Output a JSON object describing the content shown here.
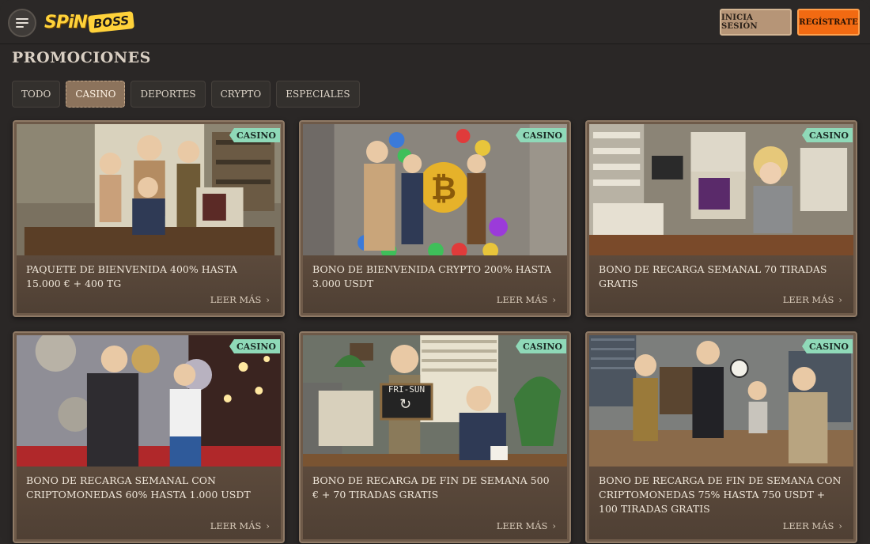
{
  "header": {
    "logo_main": "SPiN",
    "logo_sub": "BOSS",
    "login_label": "INICIA SESIÓN",
    "register_label": "REGÍSTRATE"
  },
  "page_title": "PROMOCIONES",
  "tabs": [
    {
      "label": "TODO",
      "active": false
    },
    {
      "label": "CASINO",
      "active": true
    },
    {
      "label": "DEPORTES",
      "active": false
    },
    {
      "label": "CRYPTO",
      "active": false
    },
    {
      "label": "ESPECIALES",
      "active": false
    }
  ],
  "cards": [
    {
      "badge": "CASINO",
      "title": "PAQUETE DE BIENVENIDA 400% HASTA 15.000 € + 400 TG",
      "more": "LEER MÁS"
    },
    {
      "badge": "CASINO",
      "title": "BONO DE BIENVENIDA CRYPTO 200% HASTA 3.000 USDT",
      "more": "LEER MÁS"
    },
    {
      "badge": "CASINO",
      "title": "BONO DE RECARGA SEMANAL 70 TIRADAS GRATIS",
      "more": "LEER MÁS"
    },
    {
      "badge": "CASINO",
      "title": "BONO DE RECARGA SEMANAL CON CRIPTOMONEDAS 60% HASTA 1.000 USDT",
      "more": "LEER MÁS"
    },
    {
      "badge": "CASINO",
      "title": "BONO DE RECARGA DE FIN DE SEMANA 500 € + 70 TIRADAS GRATIS",
      "more": "LEER MÁS",
      "sign_text": "FRI-SUN"
    },
    {
      "badge": "CASINO",
      "title": "BONO DE RECARGA DE FIN DE SEMANA CON CRIPTOMONEDAS 75% HASTA 750 USDT + 100 TIRADAS GRATIS",
      "more": "LEER MÁS"
    }
  ],
  "colors": {
    "background": "#2b2827",
    "accent_orange": "#f26a12",
    "badge": "#8fd9b8",
    "card": "#6e5a49"
  }
}
